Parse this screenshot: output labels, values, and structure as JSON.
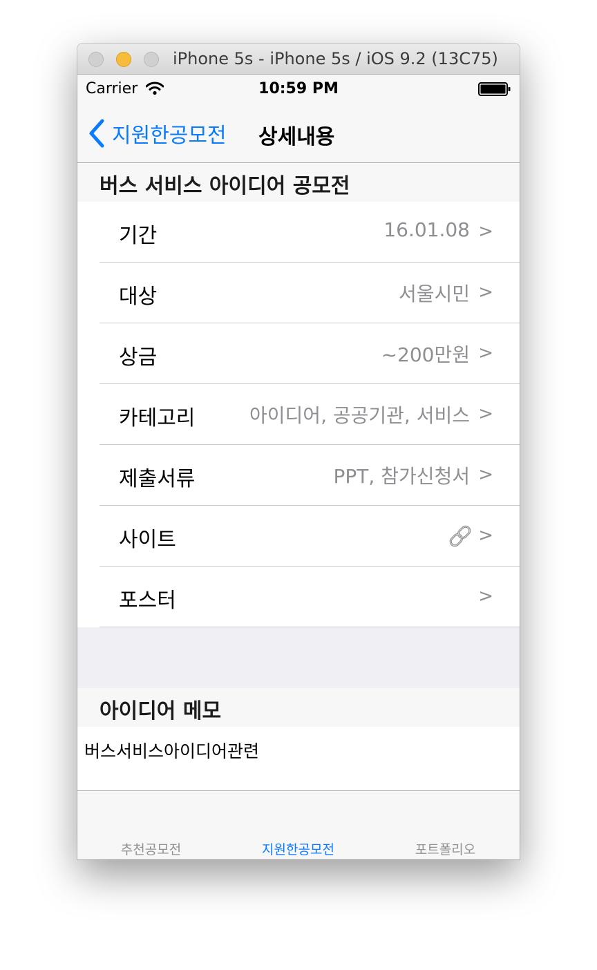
{
  "window": {
    "title": "iPhone 5s - iPhone 5s / iOS 9.2 (13C75)"
  },
  "statusbar": {
    "carrier": "Carrier",
    "time": "10:59 PM"
  },
  "navbar": {
    "back_label": "지원한공모전",
    "title": "상세내용"
  },
  "section": {
    "title": "버스 서비스 아이디어 공모전"
  },
  "rows": [
    {
      "label": "기간",
      "value": "16.01.08",
      "chevron": ">"
    },
    {
      "label": "대상",
      "value": "서울시민",
      "chevron": ">"
    },
    {
      "label": "상금",
      "value": "~200만원",
      "chevron": ">"
    },
    {
      "label": "카테고리",
      "value": "아이디어, 공공기관, 서비스",
      "chevron": ">"
    },
    {
      "label": "제출서류",
      "value": "PPT, 참가신청서",
      "chevron": ">"
    },
    {
      "label": "사이트",
      "icon": "link-icon",
      "chevron": ">"
    },
    {
      "label": "포스터",
      "chevron": ">"
    }
  ],
  "memo": {
    "header": "아이디어 메모",
    "text": "버스서비스아이디어관련"
  },
  "tabbar": {
    "tabs": [
      {
        "label": "추천공모전",
        "selected": false
      },
      {
        "label": "지원한공모전",
        "selected": true
      },
      {
        "label": "포트폴리오",
        "selected": false
      }
    ]
  },
  "colors": {
    "tint": "#0a7aff",
    "secondary_text": "#8e8e93",
    "group_background": "#efeff4",
    "tab_inactive": "#929292"
  }
}
